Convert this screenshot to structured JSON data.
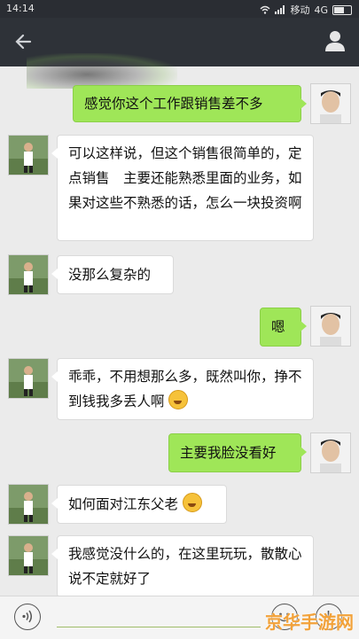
{
  "status_bar": {
    "time": "14:14",
    "carrier": "移动",
    "network": "4G"
  },
  "title_bar": {
    "back_icon": "arrow-left-icon",
    "profile_icon": "person-icon"
  },
  "messages": [
    {
      "sender": "self",
      "text": "感觉你这个工作跟销售差不多"
    },
    {
      "sender": "other",
      "text": "可以这样说，但这个销售很简单的，定点销售　主要还能熟悉里面的业务，如果对这些不熟悉的话，怎么一块投资啊"
    },
    {
      "sender": "other",
      "text": "没那么复杂的"
    },
    {
      "sender": "self",
      "text": "嗯"
    },
    {
      "sender": "other",
      "text": "乖乖，不用想那么多，既然叫你，挣不到钱我多丢人啊",
      "emoji": "laughing-tears-emoji"
    },
    {
      "sender": "self",
      "text": "主要我脸没看好"
    },
    {
      "sender": "other",
      "text": "如何面对江东父老",
      "emoji": "laughing-tears-emoji"
    },
    {
      "sender": "other",
      "text": "我感觉没什么的，在这里玩玩，散散心 说不定就好了"
    }
  ],
  "input_bar": {
    "voice_icon": "voice-icon",
    "emoji_icon": "smiley-icon",
    "more_icon": "plus-icon"
  },
  "watermark": "京华手游网",
  "colors": {
    "titlebar": "#2e3238",
    "self_bubble": "#9fe658",
    "other_bubble": "#ffffff",
    "background": "#ebebeb"
  }
}
